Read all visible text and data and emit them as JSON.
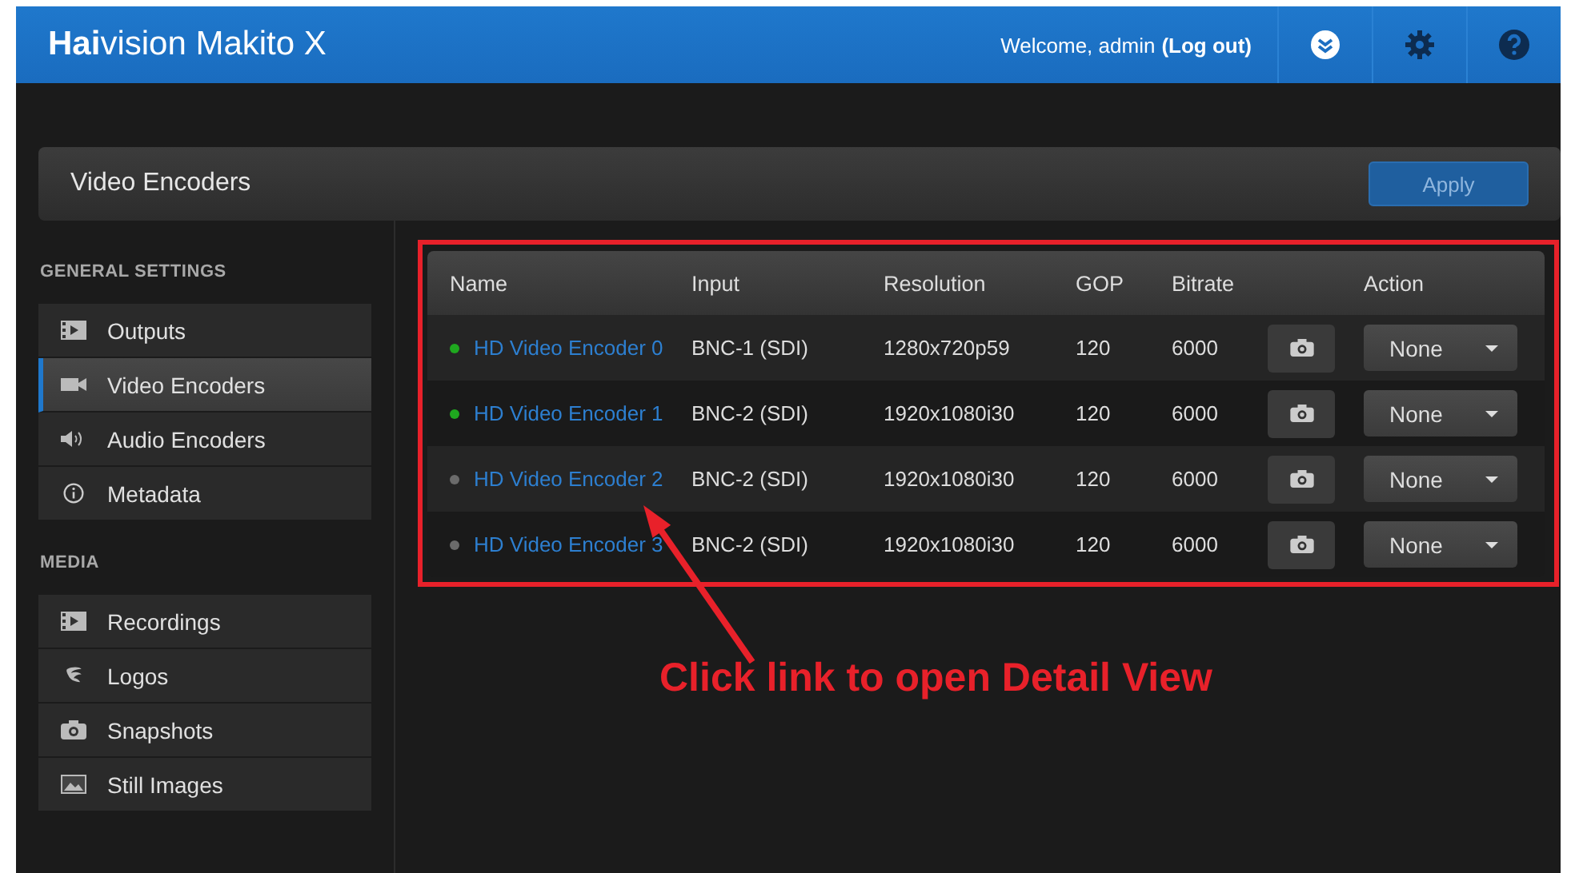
{
  "header": {
    "logo": "**Hai**vision Makito X",
    "welcome": "Welcome, admin",
    "logout": "(Log out)"
  },
  "page_title": "Video Encoders",
  "apply_button": "Apply",
  "sidebar": {
    "sections": [
      {
        "title": "GENERAL SETTINGS",
        "items": [
          {
            "label": "Outputs",
            "selected": false
          },
          {
            "label": "Video Encoders",
            "selected": true
          },
          {
            "label": "Audio Encoders",
            "selected": false
          },
          {
            "label": "Metadata",
            "selected": false
          }
        ]
      },
      {
        "title": "MEDIA",
        "items": [
          {
            "label": "Recordings",
            "selected": false
          },
          {
            "label": "Logos",
            "selected": false
          },
          {
            "label": "Snapshots",
            "selected": false
          },
          {
            "label": "Still Images",
            "selected": false
          }
        ]
      }
    ]
  },
  "table": {
    "columns": [
      "Name",
      "Input",
      "Resolution",
      "GOP",
      "Bitrate",
      "Action"
    ],
    "rows": [
      {
        "name": "HD Video Encoder 0",
        "color": "#1fa81f",
        "input": "BNC-1 (SDI)",
        "resolution": "1280x720p59",
        "gop": "120",
        "bitrate": "6000",
        "action": "None"
      },
      {
        "name": "HD Video Encoder 1",
        "color": "#1fa81f",
        "input": "BNC-2 (SDI)",
        "resolution": "1920x1080i30",
        "gop": "120",
        "bitrate": "6000",
        "action": "None"
      },
      {
        "name": "HD Video Encoder 2",
        "color": "#6b6b6b",
        "input": "BNC-2 (SDI)",
        "resolution": "1920x1080i30",
        "gop": "120",
        "bitrate": "6000",
        "action": "None"
      },
      {
        "name": "HD Video Encoder 3",
        "color": "#6b6b6b",
        "input": "BNC-2 (SDI)",
        "resolution": "1920x1080i30",
        "gop": "120",
        "bitrate": "6000",
        "action": "None"
      }
    ]
  },
  "annotation": {
    "text": "Click link to open Detail View"
  }
}
